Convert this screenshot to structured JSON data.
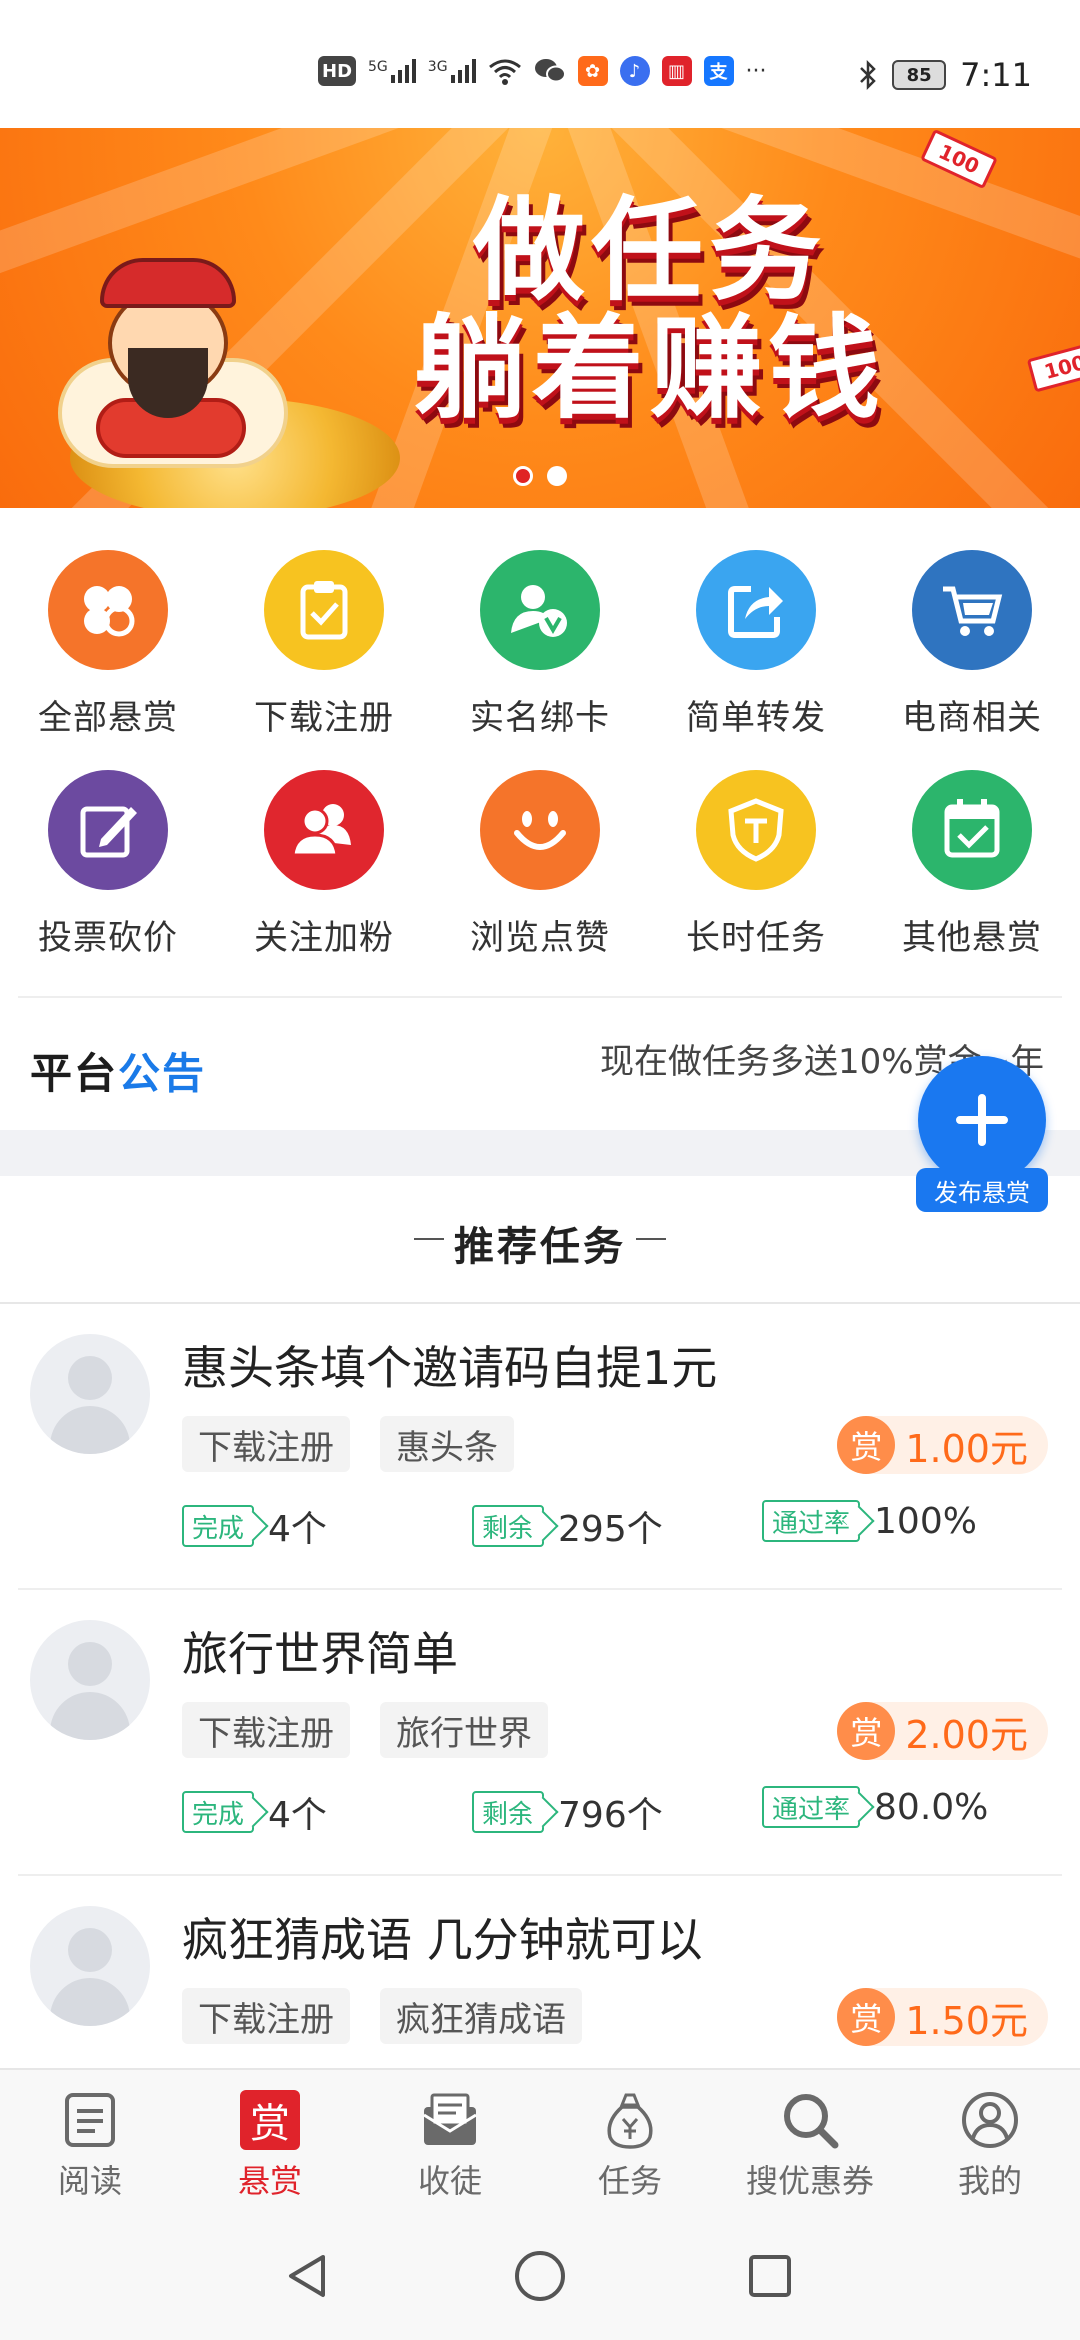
{
  "status_bar": {
    "hd": "HD",
    "net1": "5G",
    "net2": "3G",
    "battery": "85",
    "time": "7:11",
    "more": "···"
  },
  "banner": {
    "title_line1": "做任务",
    "title_line2": "躺着赚钱",
    "ticket": "100",
    "slide_count": 2,
    "active_slide": 1
  },
  "categories": [
    {
      "label": "全部悬赏",
      "color": "#f5742a",
      "icon": "clover-icon"
    },
    {
      "label": "下载注册",
      "color": "#f7c320",
      "icon": "clipboard-check-icon"
    },
    {
      "label": "实名绑卡",
      "color": "#2cb56c",
      "icon": "verified-user-icon"
    },
    {
      "label": "简单转发",
      "color": "#3aa5f0",
      "icon": "share-icon"
    },
    {
      "label": "电商相关",
      "color": "#2f74c0",
      "icon": "cart-icon"
    },
    {
      "label": "投票砍价",
      "color": "#6c4aa0",
      "icon": "pencil-icon"
    },
    {
      "label": "关注加粉",
      "color": "#e0262e",
      "icon": "users-icon"
    },
    {
      "label": "浏览点赞",
      "color": "#f5742a",
      "icon": "smile-icon"
    },
    {
      "label": "长时任务",
      "color": "#f7c320",
      "icon": "shield-icon"
    },
    {
      "label": "其他悬赏",
      "color": "#2cb56c",
      "icon": "calendar-check-icon"
    }
  ],
  "notice": {
    "logo_part1": "平台",
    "logo_part2": "公告",
    "text": "现在做任务多送10%赏金~年"
  },
  "fab": {
    "label": "发布悬赏"
  },
  "recommended": {
    "title": "推荐任务"
  },
  "tasks": [
    {
      "title": "惠头条填个邀请码自提1元",
      "tags": [
        "下载注册",
        "惠头条"
      ],
      "reward_badge": "赏",
      "reward": "1.00元",
      "done_label": "完成",
      "done": "4个",
      "left_label": "剩余",
      "left": "295个",
      "rate_label": "通过率",
      "rate": "100%"
    },
    {
      "title": "旅行世界简单",
      "tags": [
        "下载注册",
        "旅行世界"
      ],
      "reward_badge": "赏",
      "reward": "2.00元",
      "done_label": "完成",
      "done": "4个",
      "left_label": "剩余",
      "left": "796个",
      "rate_label": "通过率",
      "rate": "80.0%"
    },
    {
      "title": "疯狂猜成语 几分钟就可以",
      "tags": [
        "下载注册",
        "疯狂猜成语"
      ],
      "reward_badge": "赏",
      "reward": "1.50元"
    }
  ],
  "bottom_nav": [
    {
      "label": "阅读",
      "icon": "read-icon"
    },
    {
      "label": "悬赏",
      "icon_text": "赏",
      "active": true
    },
    {
      "label": "收徒",
      "icon": "envelope-icon"
    },
    {
      "label": "任务",
      "icon": "money-bag-icon"
    },
    {
      "label": "搜优惠券",
      "icon": "search-icon"
    },
    {
      "label": "我的",
      "icon": "profile-icon"
    }
  ]
}
